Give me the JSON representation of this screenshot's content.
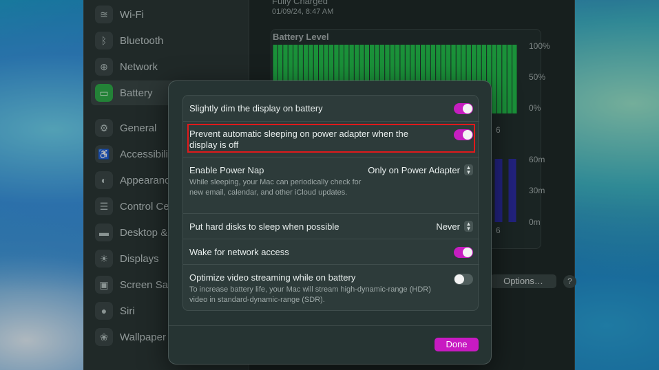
{
  "sidebar": {
    "items": [
      {
        "label": "Wi-Fi",
        "icon": "wifi-icon",
        "glyph": "≋",
        "selected": false
      },
      {
        "label": "Bluetooth",
        "icon": "bluetooth-icon",
        "glyph": "ᛒ",
        "selected": false
      },
      {
        "label": "Network",
        "icon": "globe-icon",
        "glyph": "⊕",
        "selected": false
      },
      {
        "label": "Battery",
        "icon": "battery-icon",
        "glyph": "▭",
        "selected": true
      },
      {
        "label": "General",
        "icon": "gear-icon",
        "glyph": "⚙",
        "selected": false
      },
      {
        "label": "Accessibility",
        "icon": "accessibility-icon",
        "glyph": "♿",
        "selected": false
      },
      {
        "label": "Appearance",
        "icon": "appearance-icon",
        "glyph": "◐",
        "selected": false
      },
      {
        "label": "Control Centre",
        "icon": "control-centre-icon",
        "glyph": "☰",
        "selected": false
      },
      {
        "label": "Desktop & Dock",
        "icon": "desktop-dock-icon",
        "glyph": "▬",
        "selected": false
      },
      {
        "label": "Displays",
        "icon": "displays-icon",
        "glyph": "☀",
        "selected": false
      },
      {
        "label": "Screen Saver",
        "icon": "screen-saver-icon",
        "glyph": "▣",
        "selected": false
      },
      {
        "label": "Siri",
        "icon": "siri-icon",
        "glyph": "●",
        "selected": false
      },
      {
        "label": "Wallpaper",
        "icon": "wallpaper-icon",
        "glyph": "❀",
        "selected": false
      }
    ]
  },
  "battery_info": {
    "status": "Fully Charged",
    "timestamp": "01/09/24, 8:47 AM",
    "chart_title": "Battery Level",
    "level_ticks": [
      "100%",
      "50%",
      "0%"
    ],
    "level_x_tick": "6",
    "usage_ticks": [
      "60m",
      "30m",
      "0m"
    ],
    "usage_x_tick": "6"
  },
  "chart_data": [
    {
      "type": "bar",
      "title": "Battery Level",
      "ylim": [
        0,
        100
      ],
      "yticks": [
        "100%",
        "50%",
        "0%"
      ],
      "values": [
        100,
        100,
        100,
        100,
        100,
        100,
        100,
        100,
        100,
        100,
        100,
        100,
        100,
        100,
        100,
        100,
        100,
        100,
        100,
        100,
        100,
        100,
        100,
        100,
        100,
        100,
        100,
        100,
        100,
        100,
        100,
        100,
        100,
        100,
        100,
        100,
        100,
        100,
        100,
        100,
        100,
        100,
        100,
        100,
        100,
        100,
        100,
        100
      ],
      "color": "#23c24d"
    },
    {
      "type": "bar",
      "title": "",
      "ylim": [
        0,
        60
      ],
      "yticks": [
        "60m",
        "30m",
        "0m"
      ],
      "values": [
        60,
        60,
        60
      ],
      "color": "#2e2ea8"
    }
  ],
  "footer": {
    "options_label": "Options…",
    "help_label": "?"
  },
  "sheet": {
    "rows": [
      {
        "title": "Slightly dim the display on battery",
        "toggle": true
      },
      {
        "title": "Prevent automatic sleeping on power adapter when the display is off",
        "toggle": true
      },
      {
        "title": "Enable Power Nap",
        "description": "While sleeping, your Mac can periodically check for new email, calendar, and other iCloud updates.",
        "popup": "Only on Power Adapter"
      },
      {
        "title": "Put hard disks to sleep when possible",
        "popup": "Never"
      },
      {
        "title": "Wake for network access",
        "toggle": true
      },
      {
        "title": "Optimize video streaming while on battery",
        "description": "To increase battery life, your Mac will stream high-dynamic-range (HDR) video in standard-dynamic-range (SDR).",
        "toggle": false
      }
    ],
    "done_label": "Done"
  },
  "colors": {
    "accent": "#c81ac2",
    "highlight": "#e0191b",
    "battery_green": "#23c24d",
    "usage_blue": "#2e2ea8"
  }
}
